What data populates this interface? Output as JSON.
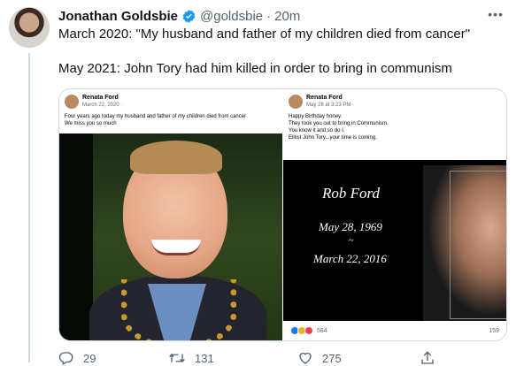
{
  "tweet": {
    "author": "Jonathan Goldsbie",
    "handle": "@goldsbie",
    "separator": "·",
    "time": "20m",
    "line1": "March 2020: \"My husband and father of my children died from cancer\"",
    "line2": "May 2021: John Tory had him killed in order to bring in communism"
  },
  "media": {
    "left": {
      "name": "Renata Ford",
      "date": "March 22, 2020 · ",
      "text1": "Four years ago today my husband and father of my children died from cancer",
      "text2": "We miss you so much"
    },
    "right": {
      "name": "Renata Ford",
      "date": "May 28 at 3:23 PM · ",
      "lines": [
        "Happy Birthday  honey.",
        "They took you out to bring in Communism.",
        "You know it and so do I.",
        "Elitist John Tory...your time is coming."
      ],
      "memorial_name": "Rob Ford",
      "memorial_birth": "May 28, 1969",
      "memorial_dash": "~",
      "memorial_death": "March 22, 2016",
      "reactions_count": "584",
      "comments_count": "159"
    }
  },
  "actions": {
    "replies": "29",
    "retweets": "131",
    "likes": "275"
  },
  "icons": [
    "verified-icon",
    "more-icon",
    "reply-icon",
    "retweet-icon",
    "like-icon",
    "share-icon"
  ],
  "colors": {
    "verified": "#1d9bf0",
    "secondary": "#536471"
  }
}
